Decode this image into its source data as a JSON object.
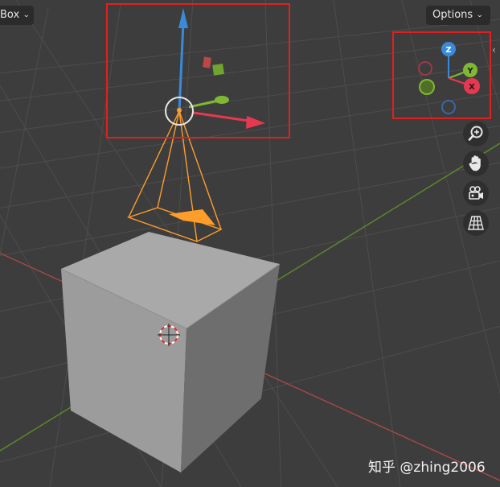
{
  "header": {
    "mode_dropdown_label": "Box",
    "options_dropdown_label": "Options"
  },
  "gizmo": {
    "z_label": "Z",
    "y_label": "Y",
    "x_label": "X"
  },
  "tools": {
    "zoom_icon": "zoom-icon",
    "pan_icon": "hand-icon",
    "camera_icon": "camera-icon",
    "ortho_icon": "grid-icon"
  },
  "colors": {
    "x_axis": "#e8384f",
    "y_axis": "#7fb832",
    "z_axis": "#3b8ad9",
    "selection": "#ff9d2b",
    "highlight_box": "#e02020"
  },
  "watermark": {
    "site": "知乎",
    "handle": "@zhing2006"
  }
}
